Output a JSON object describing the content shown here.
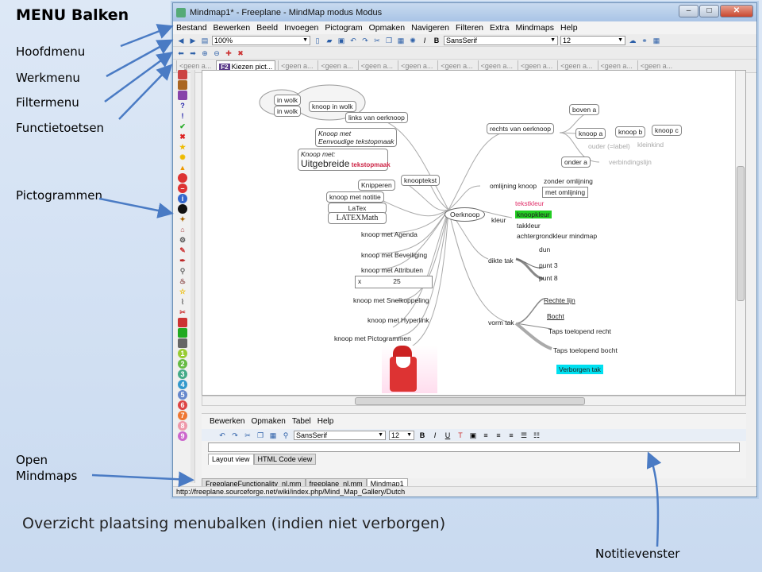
{
  "slide": {
    "title": "MENU Balken",
    "labels": {
      "hoofdmenu": "Hoofdmenu",
      "werkmenu": "Werkmenu",
      "filtermenu": "Filtermenu",
      "functietoetsen": "Functietoetsen",
      "pictogrammen": "Pictogrammen",
      "open_mindmaps": "Open\nMindmaps"
    },
    "caption": "Overzicht plaatsing menubalken (indien niet verborgen)",
    "note_label": "Notitievenster"
  },
  "window": {
    "title": "Mindmap1* - Freeplane - MindMap modus Modus",
    "menu": [
      "Bestand",
      "Bewerken",
      "Beeld",
      "Invoegen",
      "Pictogram",
      "Opmaken",
      "Navigeren",
      "Filteren",
      "Extra",
      "Mindmaps",
      "Help"
    ],
    "zoom": "100%",
    "font": "SansSerif",
    "font_size": "12",
    "fkeys": [
      {
        "key": "",
        "label": "<geen a..."
      },
      {
        "key": "F2",
        "label": "Kiezen pict..."
      },
      {
        "key": "",
        "label": "<geen a..."
      },
      {
        "key": "",
        "label": "<geen a..."
      },
      {
        "key": "",
        "label": "<geen a..."
      },
      {
        "key": "",
        "label": "<geen a..."
      },
      {
        "key": "",
        "label": "<geen a..."
      },
      {
        "key": "",
        "label": "<geen a..."
      },
      {
        "key": "",
        "label": "<geen a..."
      },
      {
        "key": "",
        "label": "<geen a..."
      },
      {
        "key": "",
        "label": "<geen a..."
      },
      {
        "key": "",
        "label": "<geen a..."
      }
    ],
    "mindmap": {
      "root": "Oerknoop",
      "nodes": [
        "links van oerknoop",
        "knoop in wolk",
        "in wolk",
        "in wolk",
        "Knoop met\nEenvoudige tekstopmaak",
        "Knoop met:",
        "Uitgebreide",
        "tekstopmaak",
        "knooptekst",
        "Knipperen",
        "knoop met notitie",
        "LaTex",
        "LATEXMath",
        "knoop met Agenda",
        "knoop met Beveiliging",
        "knoop met Attributen",
        "x",
        "25",
        "knoop met Snelkoppeling",
        "knoop met Hyperlink",
        "knoop met Pictogrammen",
        "rechts van oerknoop",
        "boven a",
        "knoop a",
        "knoop b",
        "knoop c",
        "onder a",
        "ouder (=label)",
        "kleinkind",
        "verbindingslijn",
        "omlijning knoop",
        "zonder omlijning",
        "met omlijning",
        "kleur",
        "tekstkleur",
        "knoopkleur",
        "takkleur",
        "achtergrondkleur mindmap",
        "dikte tak",
        "dun",
        "punt 3",
        "punt 8",
        "vorm tak",
        "Rechte lijn",
        "Bocht",
        "Taps toelopend recht",
        "Taps toelopend bocht",
        "Verborgen tak"
      ]
    },
    "note_panel": {
      "menu": [
        "Bewerken",
        "Opmaken",
        "Tabel",
        "Help"
      ],
      "font": "SansSerif",
      "font_size": "12",
      "tabs": [
        "Layout view",
        "HTML Code view"
      ]
    },
    "map_tabs": [
      "FreeplaneFunctionality_nl.mm",
      "freeplane_nl.mm",
      "Mindmap1"
    ],
    "status": "http://freeplane.sourceforge.net/wiki/index.php/Mind_Map_Gallery/Dutch"
  },
  "colors": {
    "accent": "#4a7bc4",
    "highlight_green": "#22cc22",
    "highlight_cyan": "#00e0f0",
    "text_color_node": "#e0306a"
  }
}
